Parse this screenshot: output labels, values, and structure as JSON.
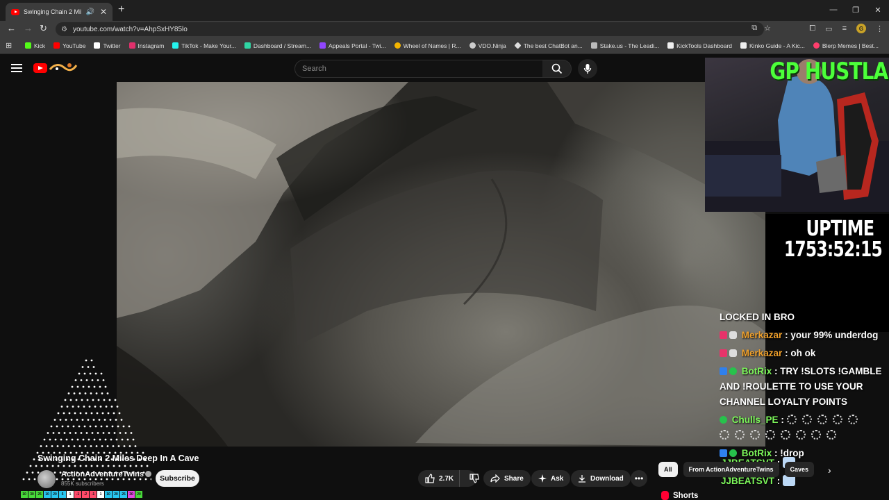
{
  "browser": {
    "tab_title": "Swinging Chain 2 Miles Deep In A Cave",
    "url": "youtube.com/watch?v=AhpSxHY85lo",
    "bookmarks": [
      {
        "label": "Kick",
        "color": "#53fc18"
      },
      {
        "label": "YouTube",
        "color": "#ff0000"
      },
      {
        "label": "Twitter",
        "color": "#ffffff"
      },
      {
        "label": "Instagram",
        "color": "#e1306c"
      },
      {
        "label": "TikTok - Make Your...",
        "color": "#25f4ee"
      },
      {
        "label": "Dashboard / Stream...",
        "color": "#2fd6a4"
      },
      {
        "label": "Appeals Portal - Twi...",
        "color": "#9146ff"
      },
      {
        "label": "Wheel of Names | R...",
        "color": "#f4b400"
      },
      {
        "label": "VDO.Ninja",
        "color": "#cccccc"
      },
      {
        "label": "The best ChatBot an...",
        "color": "#dddddd"
      },
      {
        "label": "Stake.us - The Leadi...",
        "color": "#bbbbbb"
      },
      {
        "label": "KickTools Dashboard",
        "color": "#eeeeee"
      },
      {
        "label": "Kinko Guide - A Kic...",
        "color": "#eeeeee"
      },
      {
        "label": "Blerp Memes | Best...",
        "color": "#ff3e6c"
      }
    ]
  },
  "header": {
    "search_placeholder": "Search"
  },
  "overlay": {
    "cam_title": "GP HUSTLA",
    "uptime_label": "UPTIME",
    "uptime_value": "1753:52:15",
    "chat": {
      "line1": "LOCKED IN BRO",
      "l2_user": "Merkazar",
      "l2_msg": ": your 99% underdog",
      "l3_user": "Merkazar",
      "l3_msg": ": oh ok",
      "l4_user": "BotRix",
      "l4_msg": ": TRY !SLOTS !GAMBLE AND !ROULETTE TO USE YOUR CHANNEL LOYALTY POINTS",
      "l5_user": "Chulls_PE",
      "l5_msg": ":",
      "l6_user": "BotRix",
      "l6_msg": ": !drop",
      "l7_user": "JJBEATSVT",
      "l7_msg": ":",
      "l8_user": "JJBEATSVT",
      "l8_msg": ":"
    }
  },
  "video": {
    "title": "Swinging Chain 2 Miles Deep In A Cave",
    "channel": "ActionAdventureTwins",
    "subscribers": "855K subscribers",
    "subscribe_label": "Subscribe",
    "likes": "2.7K",
    "share_label": "Share",
    "ask_label": "Ask",
    "download_label": "Download"
  },
  "sidebar": {
    "chips": [
      "All",
      "From ActionAdventureTwins",
      "Caves"
    ],
    "shorts_label": "Shorts"
  },
  "levels": [
    "10",
    "30",
    "25",
    "10",
    "20",
    "5",
    "1",
    "-1",
    "-2",
    "-1",
    "1",
    "10",
    "20",
    "25",
    "30",
    "20"
  ]
}
